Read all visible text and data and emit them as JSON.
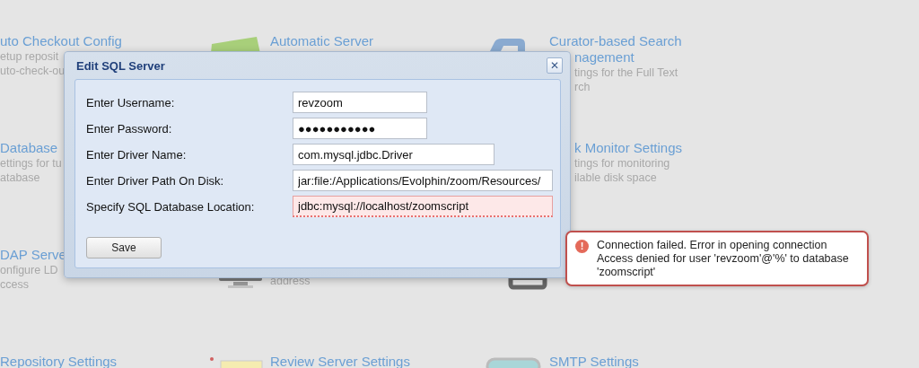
{
  "tiles": [
    {
      "title_lines": [
        "uto Checkout Config"
      ],
      "description_lines": [
        "etup reposit",
        "uto-check-ou"
      ]
    },
    {
      "title_lines": [
        "Automatic Server"
      ]
    },
    {
      "title_lines": [
        "Curator-based Search",
        "nagement"
      ],
      "description_lines": [
        "tings for the Full Text",
        "rch"
      ]
    },
    {
      "title_lines": [
        "Database"
      ],
      "description_lines": [
        "ettings for tu",
        "atabase"
      ]
    },
    {
      "title_lines": [
        "k Monitor Settings"
      ],
      "description_lines": [
        "tings for monitoring",
        "ilable disk space"
      ]
    },
    {
      "title_lines": [
        "DAP Serve"
      ],
      "description_lines": [
        "onfigure LD",
        "ccess"
      ]
    },
    {
      "description_lines": [
        "address"
      ]
    },
    {
      "title_lines": [
        "Repository Settings"
      ]
    },
    {
      "title_lines": [
        "Review Server Settings"
      ]
    },
    {
      "title_lines": [
        "SMTP Settings"
      ]
    }
  ],
  "dialog": {
    "title": "Edit SQL Server",
    "close": "✕",
    "fields": [
      {
        "label": "Enter Username:",
        "value": "revzoom",
        "invalid": false
      },
      {
        "label": "Enter Password:",
        "value": "●●●●●●●●●●●",
        "invalid": false
      },
      {
        "label": "Enter Driver Name:",
        "value": "com.mysql.jdbc.Driver",
        "invalid": false
      },
      {
        "label": "Enter Driver Path On Disk:",
        "value": "jar:file:/Applications/Evolphin/zoom/Resources/",
        "invalid": false
      },
      {
        "label": "Specify SQL Database Location:",
        "value": "jdbc:mysql://localhost/zoomscript",
        "invalid": true
      }
    ],
    "save_button": "Save"
  },
  "error_toast": {
    "icon": "!",
    "message": "Connection failed. Error in opening connection Access denied for user 'revzoom'@'%' to database 'zoomscript'"
  }
}
